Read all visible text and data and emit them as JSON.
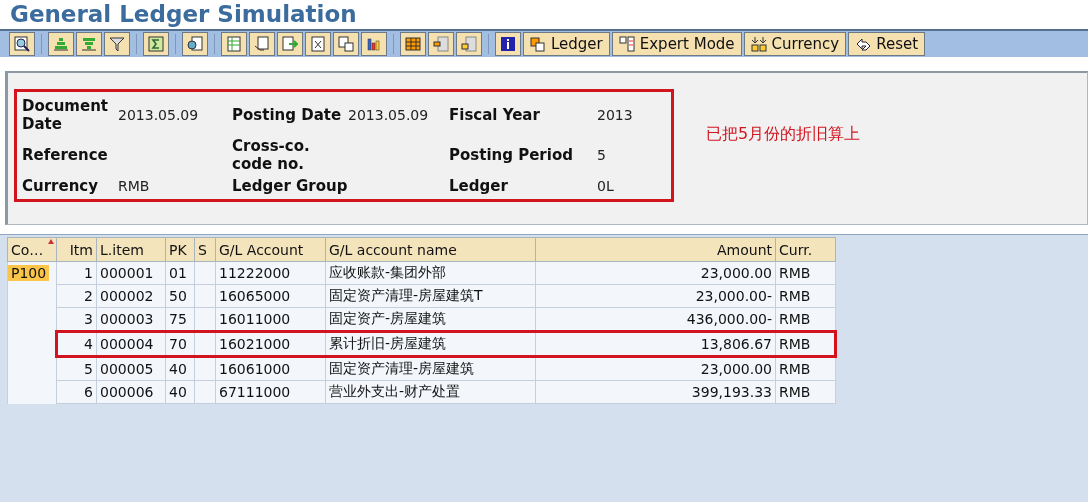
{
  "window": {
    "title": "General Ledger Simulation"
  },
  "toolbar": {
    "buttons": [
      {
        "kind": "ledger",
        "label": "Ledger"
      },
      {
        "kind": "expert",
        "label": "Expert Mode"
      },
      {
        "kind": "currency",
        "label": "Currency"
      },
      {
        "kind": "reset",
        "label": "Reset"
      }
    ]
  },
  "header": {
    "fields": [
      {
        "label": "Document Date",
        "value": "2013.05.09"
      },
      {
        "label": "Posting Date",
        "value": "2013.05.09"
      },
      {
        "label": "Fiscal Year",
        "value": "2013"
      },
      {
        "label": "Reference"
      },
      {
        "label": "Cross-co. code no."
      },
      {
        "label": "Posting Period",
        "value": "5"
      },
      {
        "label": "Currency",
        "value": "RMB"
      },
      {
        "label": "Ledger Group"
      },
      {
        "label": "Ledger",
        "value": "0L"
      }
    ],
    "note": "已把5月份的折旧算上"
  },
  "table": {
    "columns": [
      {
        "label": "Co…",
        "sorted": true
      },
      {
        "label": "Itm",
        "sorted": false
      },
      {
        "label": "L.item",
        "sorted": false
      },
      {
        "label": "PK",
        "sorted": false
      },
      {
        "label": "S",
        "sorted": false
      },
      {
        "label": "G/L Account",
        "sorted": false
      },
      {
        "label": "G/L account name",
        "sorted": false
      },
      {
        "label": "Amount",
        "sorted": false
      },
      {
        "label": "Curr.",
        "sorted": false
      }
    ],
    "rows": [
      {
        "cells": [
          "P100",
          "1",
          "000001",
          "01",
          "",
          "11222000",
          "应收账款-集团外部",
          "23,000.00",
          "RMB"
        ],
        "outlined": false
      },
      {
        "cells": [
          "",
          "2",
          "000002",
          "50",
          "",
          "16065000",
          "固定资产清理-房屋建筑T",
          "23,000.00-",
          "RMB"
        ],
        "outlined": false
      },
      {
        "cells": [
          "",
          "3",
          "000003",
          "75",
          "",
          "16011000",
          "固定资产-房屋建筑",
          "436,000.00-",
          "RMB"
        ],
        "outlined": false
      },
      {
        "cells": [
          "",
          "4",
          "000004",
          "70",
          "",
          "16021000",
          "累计折旧-房屋建筑",
          "13,806.67",
          "RMB"
        ],
        "outlined": true
      },
      {
        "cells": [
          "",
          "5",
          "000005",
          "40",
          "",
          "16061000",
          "固定资产清理-房屋建筑",
          "23,000.00",
          "RMB"
        ],
        "outlined": false
      },
      {
        "cells": [
          "",
          "6",
          "000006",
          "40",
          "",
          "67111000",
          "营业外支出-财产处置",
          "399,193.33",
          "RMB"
        ],
        "outlined": false
      }
    ]
  }
}
